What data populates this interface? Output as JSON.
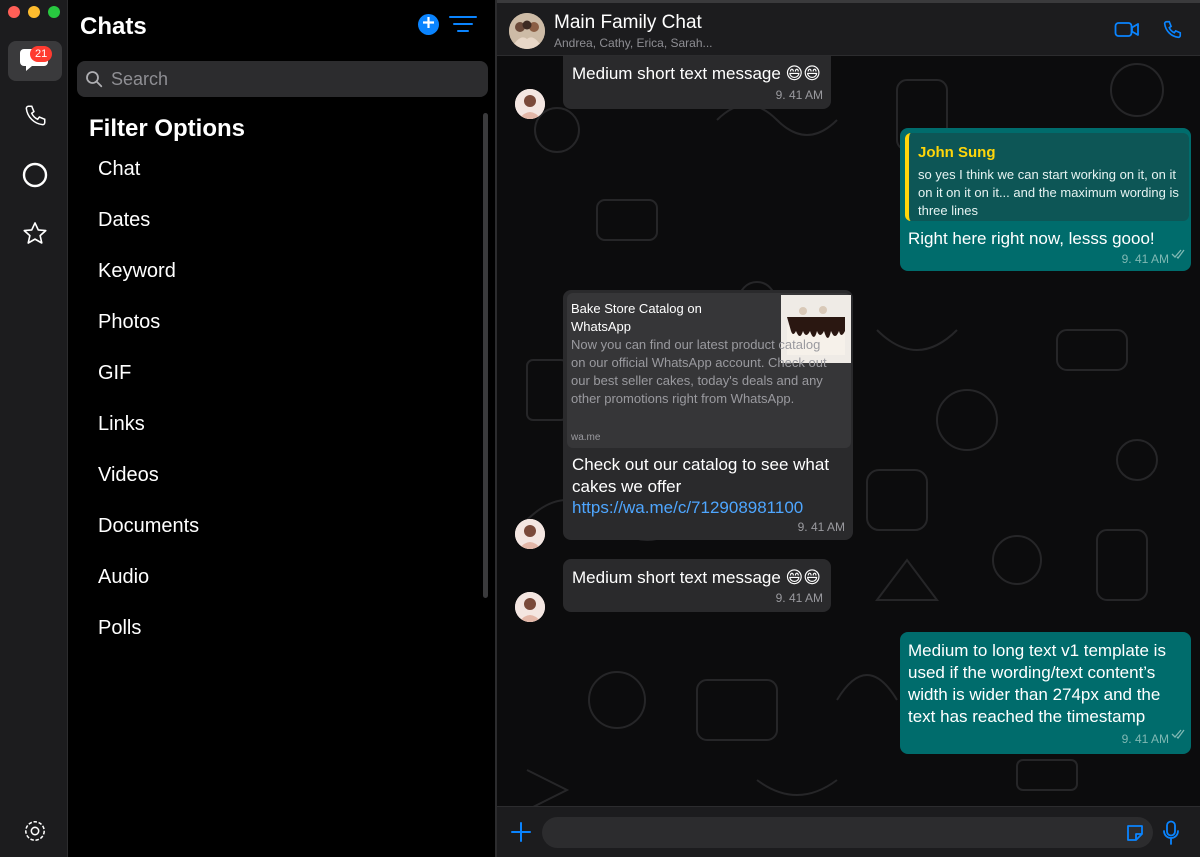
{
  "window": {
    "controls": [
      "close",
      "minimize",
      "maximize"
    ]
  },
  "rail": {
    "items": [
      {
        "name": "chats",
        "icon": "chat-bubbles-icon",
        "badge": "21",
        "active": true
      },
      {
        "name": "calls",
        "icon": "phone-icon"
      },
      {
        "name": "status",
        "icon": "status-circle-icon"
      },
      {
        "name": "starred",
        "icon": "star-icon"
      }
    ],
    "settings_icon": "gear-icon"
  },
  "panel": {
    "title": "Chats",
    "new_chat_icon": "plus-circle-icon",
    "filter_icon": "filter-lines-icon",
    "search": {
      "placeholder": "Search",
      "icon": "search-icon"
    },
    "filter_heading": "Filter Options",
    "filters": [
      "Chat",
      "Dates",
      "Keyword",
      "Photos",
      "GIF",
      "Links",
      "Videos",
      "Documents",
      "Audio",
      "Polls"
    ]
  },
  "chat": {
    "name": "Main Family Chat",
    "members": "Andrea, Cathy, Erica, Sarah...",
    "video_icon": "video-camera-icon",
    "call_icon": "phone-icon",
    "messages": [
      {
        "text": "Medium short text message 😄😄",
        "time": "9. 41 AM"
      },
      {
        "quote_author": "John Sung",
        "quote_text": "so yes I think we can start working on it, on it on it on it on it... and the maximum wording is three lines",
        "text": "Right here right now, lesss gooo!",
        "time": "9. 41 AM"
      },
      {
        "link_title": "Bake Store Catalog on WhatsApp",
        "link_desc": "Now you can find our latest product catalog on our official WhatsApp account. Check out our best seller cakes, today's deals and any other promotions right from WhatsApp.",
        "link_domain": "wa.me",
        "text": "Check out our catalog to see what cakes we offer",
        "url": "https://wa.me/c/712908981100",
        "time": "9. 41 AM"
      },
      {
        "text": "Medium short text message 😄😄",
        "time": "9. 41 AM"
      },
      {
        "text": "Medium to long text v1 template is used if the wording/text content’s width is wider than 274px and the text has reached the timestamp",
        "time": "9. 41 AM"
      }
    ]
  },
  "composer": {
    "plus_icon": "plus-icon",
    "sticker_icon": "sticker-icon",
    "mic_icon": "microphone-icon"
  },
  "colors": {
    "accent": "#0a84ff",
    "outgoing_bubble": "#006c6c",
    "incoming_bubble": "#2a2a2c",
    "quote_author": "#ffd60a",
    "link": "#4ea6ff",
    "badge": "#ff3b30"
  }
}
